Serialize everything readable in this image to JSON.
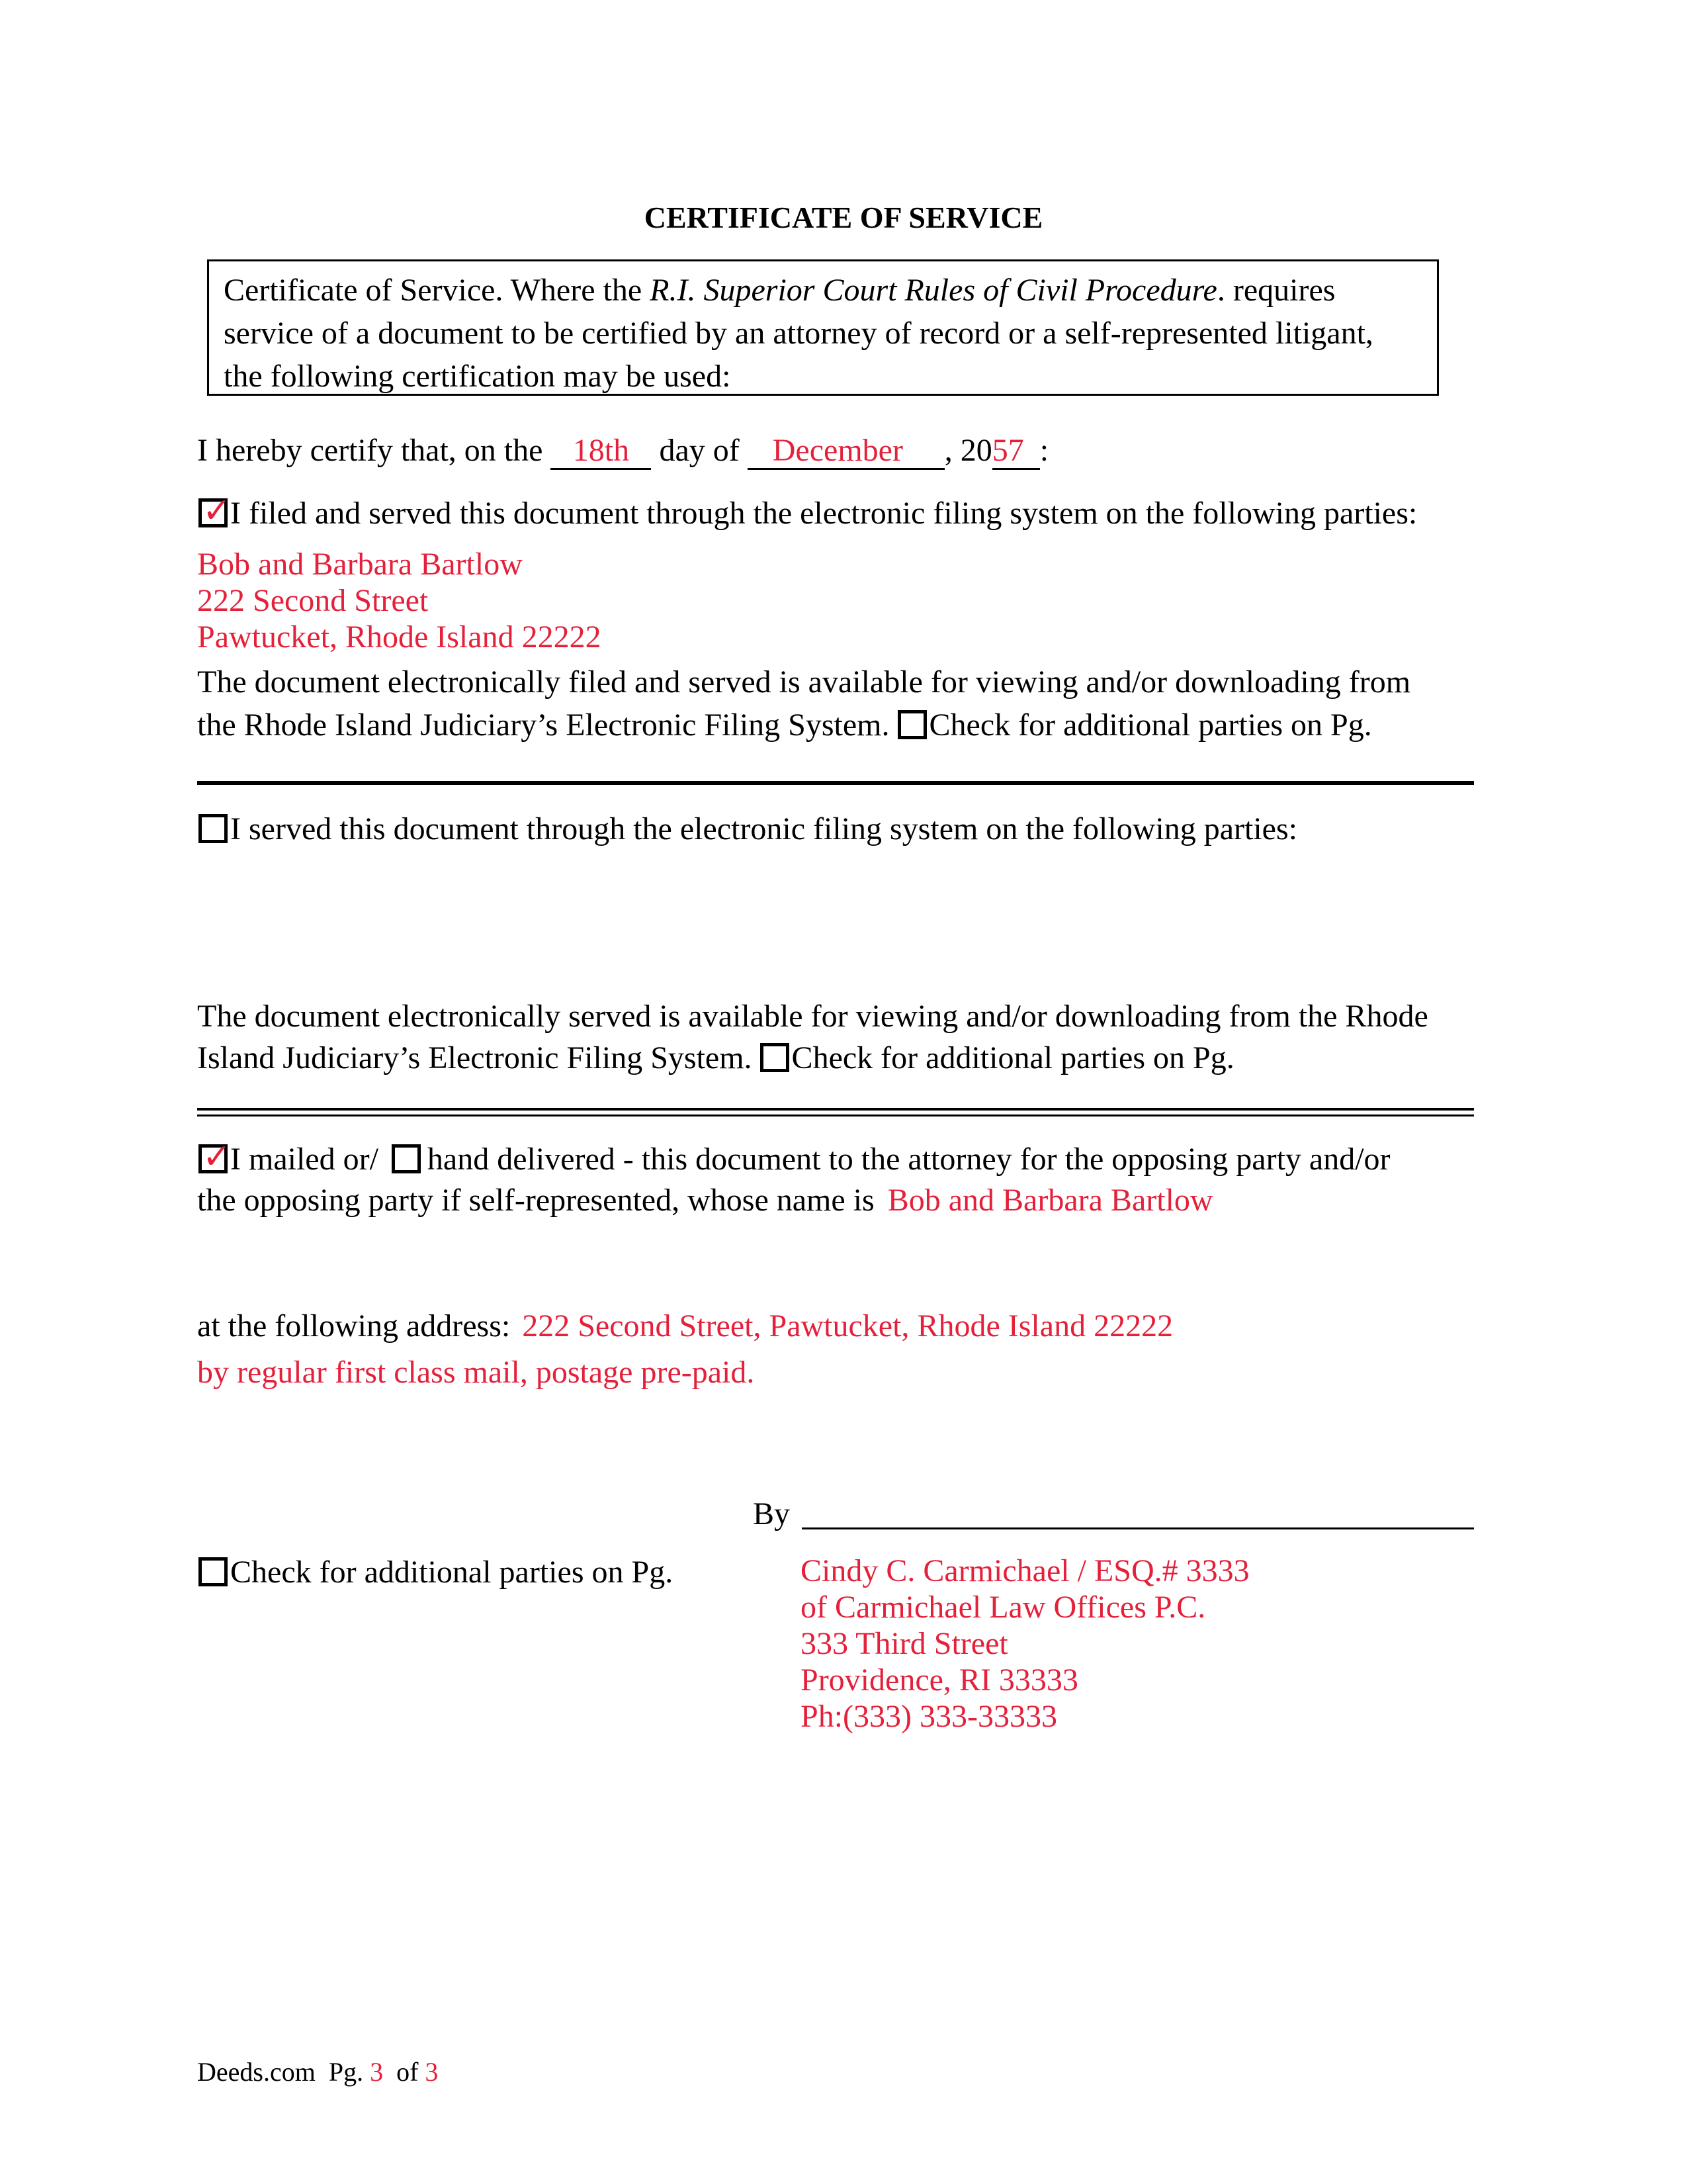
{
  "document": {
    "title": "CERTIFICATE OF SERVICE",
    "intro": {
      "line1_pre": "Certificate of Service. Where the ",
      "line1_italic_a": "R.I. ",
      "line1_italic_b": "Superior Court Rules of Civil Procedure",
      "line1_post": ". requires",
      "line2": "service of a document to be certified by an attorney of record or a self-represented litigant,",
      "line3": "the following certification may be used:"
    },
    "certify": {
      "prefix": "I hereby certify that, on the ",
      "day": "18th",
      "middle": " day of ",
      "month": "December",
      "year_prefix": ", 20",
      "year_suffix": "57",
      "end": ":"
    },
    "section_filed": {
      "checked": true,
      "label": "I filed and served this document through the electronic filing system on the following parties:",
      "parties": [
        "Bob and Barbara Bartlow",
        "222 Second Street",
        "Pawtucket, Rhode Island 22222"
      ],
      "note_line1": "The document electronically filed and served is available for viewing and/or downloading from",
      "note_line2": "the Rhode Island Judiciary’s Electronic Filing System. ",
      "additional_checked": false,
      "additional_label": "Check for additional parties on Pg."
    },
    "section_served": {
      "checked": false,
      "label": "I served this document through the electronic filing system on the following parties:",
      "note_line1": "The document electronically served is available for viewing and/or downloading from the Rhode",
      "note_line2": "Island Judiciary’s Electronic Filing System. ",
      "additional_checked": false,
      "additional_label": "Check for additional parties on Pg."
    },
    "section_mailed": {
      "mailed_checked": true,
      "mailed_label": "I mailed or/ ",
      "hand_checked": false,
      "hand_label": "hand delivered - this document to the attorney for the opposing party and/or",
      "line2": "the opposing party if self-represented, whose name is ",
      "name": "Bob and Barbara Bartlow",
      "address_label": "at the following address: ",
      "address": "222 Second Street, Pawtucket, Rhode Island 22222",
      "method": "by regular first class mail, postage pre-paid."
    },
    "signature": {
      "by_label": "By",
      "additional_checked": false,
      "additional_label": "Check for additional parties on Pg.",
      "lines": [
        "Cindy C. Carmichael / ESQ.# 3333",
        "of Carmichael Law Offices P.C.",
        "333 Third Street",
        "Providence, RI 33333",
        "Ph:(333) 333-33333"
      ]
    },
    "footer": {
      "site": "Deeds.com",
      "pg_label": "Pg.",
      "page": "3",
      "of_label": "of",
      "total": "3"
    },
    "colors": {
      "filled_text": "#e4203a",
      "text": "#000000"
    }
  }
}
